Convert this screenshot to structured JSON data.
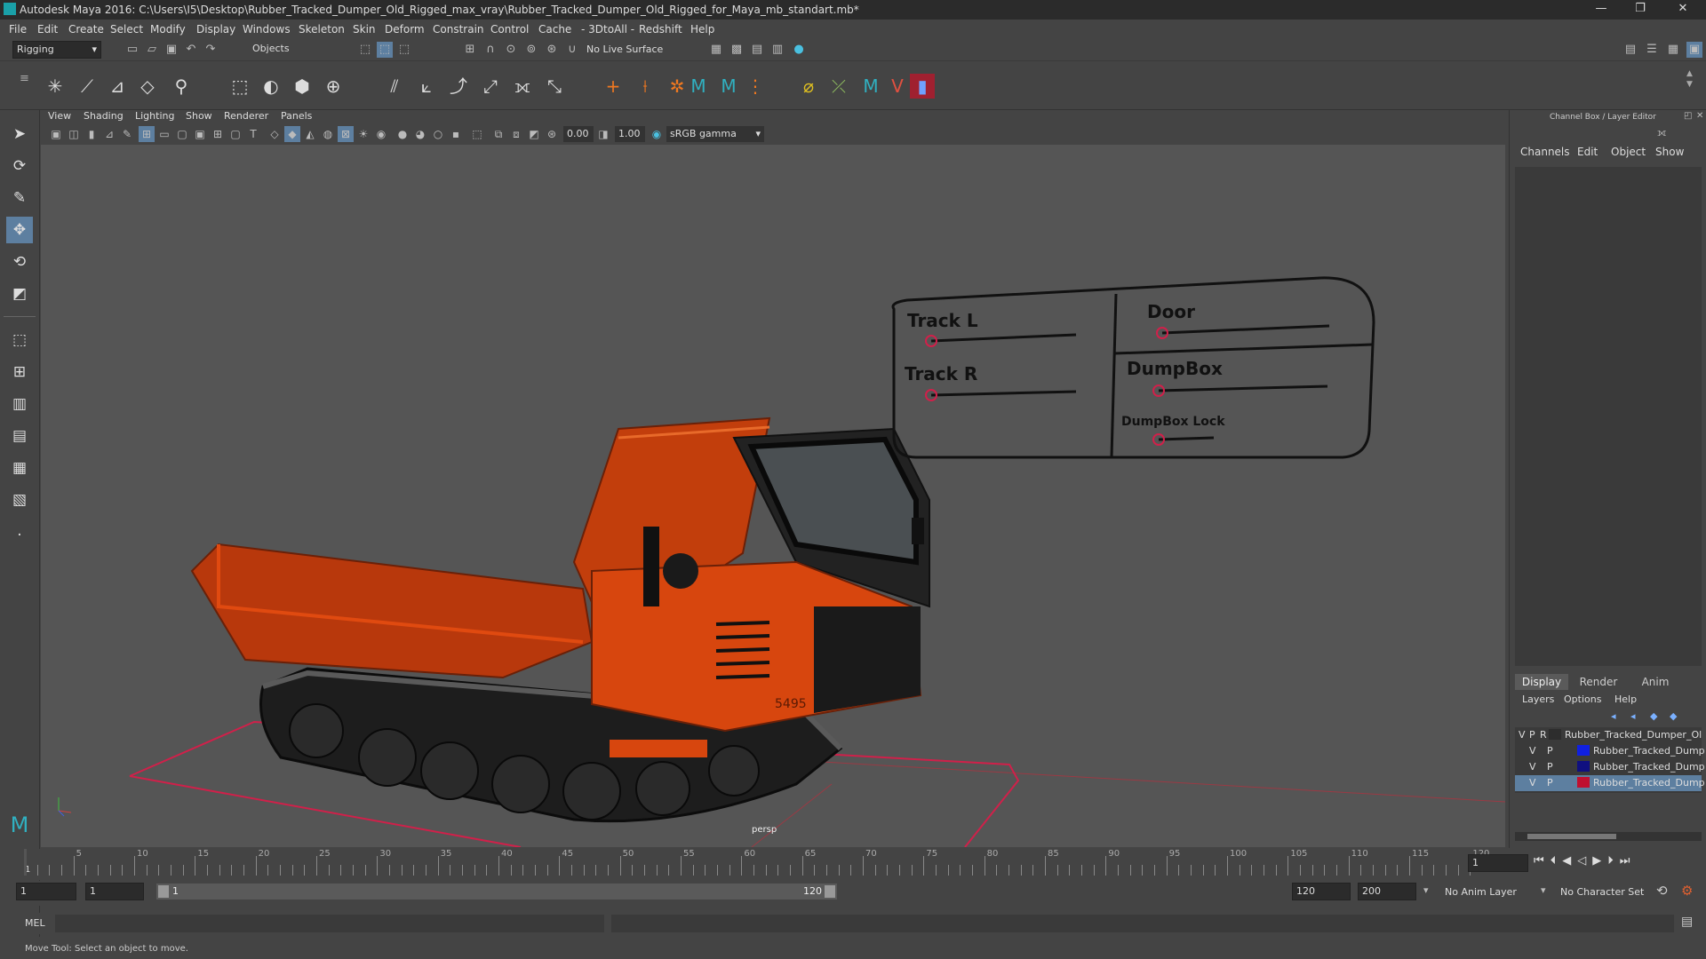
{
  "window": {
    "title": "Autodesk Maya 2016: C:\\Users\\I5\\Desktop\\Rubber_Tracked_Dumper_Old_Rigged_max_vray\\Rubber_Tracked_Dumper_Old_Rigged_for_Maya_mb_standart.mb*",
    "minimize": "—",
    "maximize": "❐",
    "close": "✕"
  },
  "menu": [
    "File",
    "Edit",
    "Create",
    "Select",
    "Modify",
    "Display",
    "Windows",
    "Skeleton",
    "Skin",
    "Deform",
    "Constrain",
    "Control",
    "Cache",
    "- 3DtoAll -",
    "Redshift",
    "Help"
  ],
  "status_line": {
    "menuset": "Rigging",
    "objects": "Objects",
    "live_surface": "No Live Surface"
  },
  "panel": {
    "menus": [
      "View",
      "Shading",
      "Lighting",
      "Show",
      "Renderer",
      "Panels"
    ],
    "field_a": "0.00",
    "field_b": "1.00",
    "color_space": "sRGB gamma",
    "camera_label": "persp"
  },
  "rig_controls": {
    "track_l": "Track L",
    "track_r": "Track R",
    "door": "Door",
    "dumpbox": "DumpBox",
    "dumpbox_lock": "DumpBox Lock"
  },
  "truck_number": "5495",
  "channel_box": {
    "title": "Channel Box / Layer Editor",
    "menus": [
      "Channels",
      "Edit",
      "Object",
      "Show"
    ],
    "tabs": [
      "Display",
      "Render",
      "Anim"
    ],
    "layer_menus": [
      "Layers",
      "Options",
      "Help"
    ],
    "layers": [
      {
        "v": "V",
        "p": "P",
        "r": "R",
        "color": "#2d2d2d",
        "name": "Rubber_Tracked_Dumper_Ol"
      },
      {
        "v": "V",
        "p": "P",
        "r": "",
        "color": "#1020e0",
        "name": "Rubber_Tracked_Dump"
      },
      {
        "v": "V",
        "p": "P",
        "r": "",
        "color": "#101080",
        "name": "Rubber_Tracked_Dump"
      },
      {
        "v": "V",
        "p": "P",
        "r": "",
        "color": "#c01030",
        "name": "Rubber_Tracked_Dump"
      }
    ]
  },
  "timeline": {
    "ticks": [
      "5",
      "10",
      "15",
      "20",
      "25",
      "30",
      "35",
      "40",
      "45",
      "50",
      "55",
      "60",
      "65",
      "70",
      "75",
      "80",
      "85",
      "90",
      "95",
      "100",
      "105",
      "110",
      "115",
      "120"
    ],
    "start_marker": "1",
    "current_frame": "1"
  },
  "range": {
    "start": "1",
    "anim_start": "1",
    "slider_start": "1",
    "slider_end": "120",
    "anim_end": "120",
    "end": "200",
    "anim_layer": "No Anim Layer",
    "char_set": "No Character Set"
  },
  "command_line": {
    "label": "MEL"
  },
  "help_line": "Move Tool: Select an object to move."
}
